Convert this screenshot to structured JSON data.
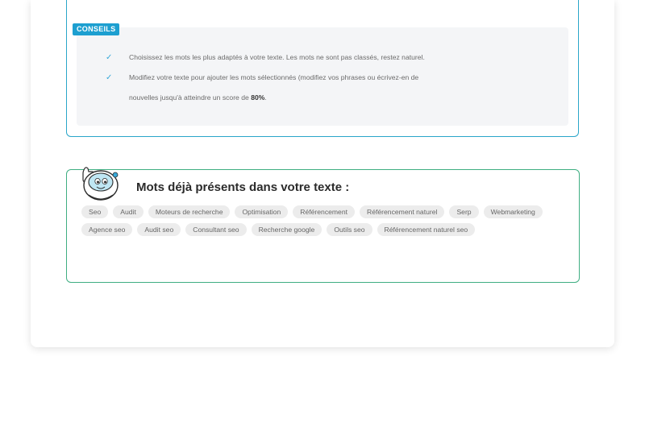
{
  "tips": {
    "badge": "CONSEILS",
    "items": [
      "Choisissez les mots les plus adaptés à votre texte. Les mots ne sont pas classés, restez naturel.",
      "Modifiez votre texte pour ajouter les mots sélectionnés (modifiez vos phrases ou écrivez-en de"
    ],
    "continuation_prefix": "nouvelles jusqu'à atteindre un score de ",
    "score": "80%",
    "continuation_suffix": "."
  },
  "present_words": {
    "title": "Mots déjà présents dans votre texte :",
    "words": [
      "Seo",
      "Audit",
      "Moteurs de recherche",
      "Optimisation",
      "Référencement",
      "Référencement naturel",
      "Serp",
      "Webmarketing",
      "Agence seo",
      "Audit seo",
      "Consultant seo",
      "Recherche google",
      "Outils seo",
      "Référencement naturel seo"
    ]
  },
  "colors": {
    "badge": "#1d9fd0",
    "check": "#38a9d9",
    "tips_border": "#2aa6c9",
    "words_border": "#3fae82"
  },
  "icons": {
    "check": "check-icon",
    "mascot": "mascot-robot-thumbs-up"
  }
}
